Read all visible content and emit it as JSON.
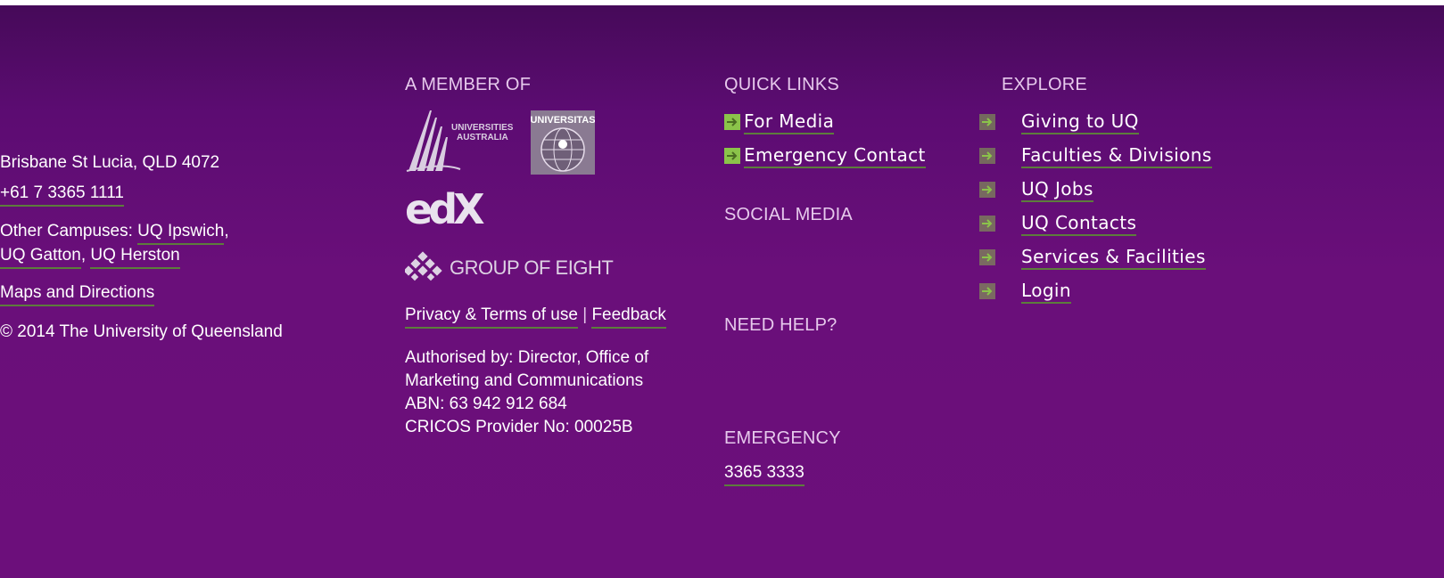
{
  "address": {
    "line": "Brisbane St Lucia, QLD 4072",
    "phone": "+61 7 3365 1111",
    "campuses_prefix": "Other Campuses: ",
    "campus_ipswich": "UQ Ipswich",
    "comma": ",",
    "campus_gatton": "UQ Gatton",
    "campus_herston": "UQ Herston",
    "maps": "Maps and Directions",
    "copyright": "© 2014 The University of Queensland"
  },
  "member": {
    "heading": "A MEMBER OF",
    "ua_line1": "UNIVERSITIES",
    "ua_line2": "AUSTRALIA",
    "universitas": "UNIVERSITAS",
    "edx": "edX",
    "go8": "GROUP OF EIGHT",
    "privacy": "Privacy & Terms of use",
    "separator": "|",
    "feedback": "Feedback",
    "authorised_1": "Authorised by: Director, Office of",
    "authorised_2": "Marketing and Communications",
    "abn": "ABN: 63 942 912 684",
    "cricos": "CRICOS Provider No: 00025B"
  },
  "quick_links": {
    "heading": "QUICK LINKS",
    "items": [
      {
        "label": "For Media"
      },
      {
        "label": "Emergency Contact"
      }
    ],
    "social_heading": "SOCIAL MEDIA",
    "help_heading": "NEED HELP?",
    "emergency_heading": "EMERGENCY",
    "emergency_number": "3365 3333"
  },
  "explore": {
    "heading": "EXPLORE",
    "items": [
      {
        "label": "Giving to UQ"
      },
      {
        "label": "Faculties & Divisions"
      },
      {
        "label": "UQ Jobs"
      },
      {
        "label": "UQ Contacts"
      },
      {
        "label": "Services & Facilities"
      },
      {
        "label": "Login"
      }
    ]
  },
  "colors": {
    "purple": "#6c0f7b",
    "heading": "#e6c9ec",
    "arrow_green": "#8bc34a",
    "underline": "#5d7d3c"
  }
}
